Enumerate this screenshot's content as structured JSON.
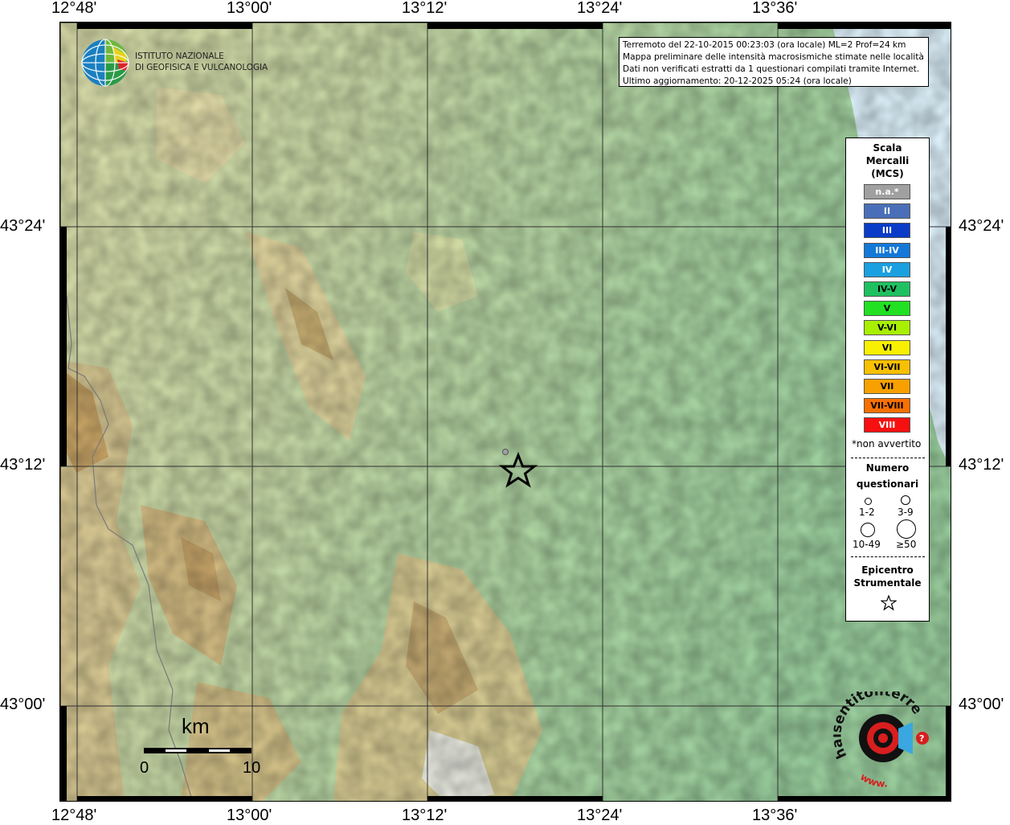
{
  "axes": {
    "top_lon_labels": [
      "12°48'",
      "13°00'",
      "13°12'",
      "13°24'",
      "13°36'"
    ],
    "bottom_lon_labels": [
      "12°48'",
      "13°00'",
      "13°12'",
      "13°24'",
      "13°36'"
    ],
    "left_lat_labels": [
      "43°24'",
      "43°12'",
      "43°00'"
    ],
    "right_lat_labels": [
      "43°24'",
      "43°12'",
      "43°00'"
    ]
  },
  "info_box": {
    "line1": "Terremoto del 22-10-2015 00:23:03 (ora locale) ML=2 Prof=24 km",
    "line2": "Mappa preliminare delle intensità macrosismiche stimate nelle località",
    "line3": "Dati non verificati estratti da 1 questionari compilati tramite Internet.",
    "line4": "Ultimo aggiornamento: 20-12-2025 05:24 (ora locale)"
  },
  "logo": {
    "line1": "ISTITUTO NAZIONALE",
    "line2": "DI GEOFISICA E VULCANOLOGIA"
  },
  "legend": {
    "title1": "Scala",
    "title2": "Mercalli",
    "title3": "(MCS)",
    "items": [
      {
        "label": "n.a.*",
        "color": "#a0a0a0",
        "text_color": "#ffffff"
      },
      {
        "label": "II",
        "color": "#4a6fb8",
        "text_color": "#ffffff"
      },
      {
        "label": "III",
        "color": "#0a3cc8",
        "text_color": "#ffffff"
      },
      {
        "label": "III-IV",
        "color": "#1478d8",
        "text_color": "#ffffff"
      },
      {
        "label": "IV",
        "color": "#1aa0e0",
        "text_color": "#ffffff"
      },
      {
        "label": "IV-V",
        "color": "#1ec060",
        "text_color": "#000000"
      },
      {
        "label": "V",
        "color": "#22e022",
        "text_color": "#000000"
      },
      {
        "label": "V-VI",
        "color": "#a8f000",
        "text_color": "#000000"
      },
      {
        "label": "VI",
        "color": "#f8f000",
        "text_color": "#000000"
      },
      {
        "label": "VI-VII",
        "color": "#f8c000",
        "text_color": "#000000"
      },
      {
        "label": "VII",
        "color": "#f8a000",
        "text_color": "#000000"
      },
      {
        "label": "VII-VIII",
        "color": "#f87000",
        "text_color": "#000000"
      },
      {
        "label": "VIII",
        "color": "#f81010",
        "text_color": "#ffffff"
      }
    ],
    "footnote": "*non avvertito",
    "count_title1": "Numero",
    "count_title2": "questionari",
    "count_labels": [
      "1-2",
      "3-9",
      "10-49",
      "≥50"
    ],
    "epicenter_title1": "Epicentro",
    "epicenter_title2": "Strumentale"
  },
  "scalebar": {
    "unit": "km",
    "start": "0",
    "end": "10"
  },
  "hsn_logo": {
    "text1": "haisentitoilterremoto.it",
    "text2": "www."
  }
}
